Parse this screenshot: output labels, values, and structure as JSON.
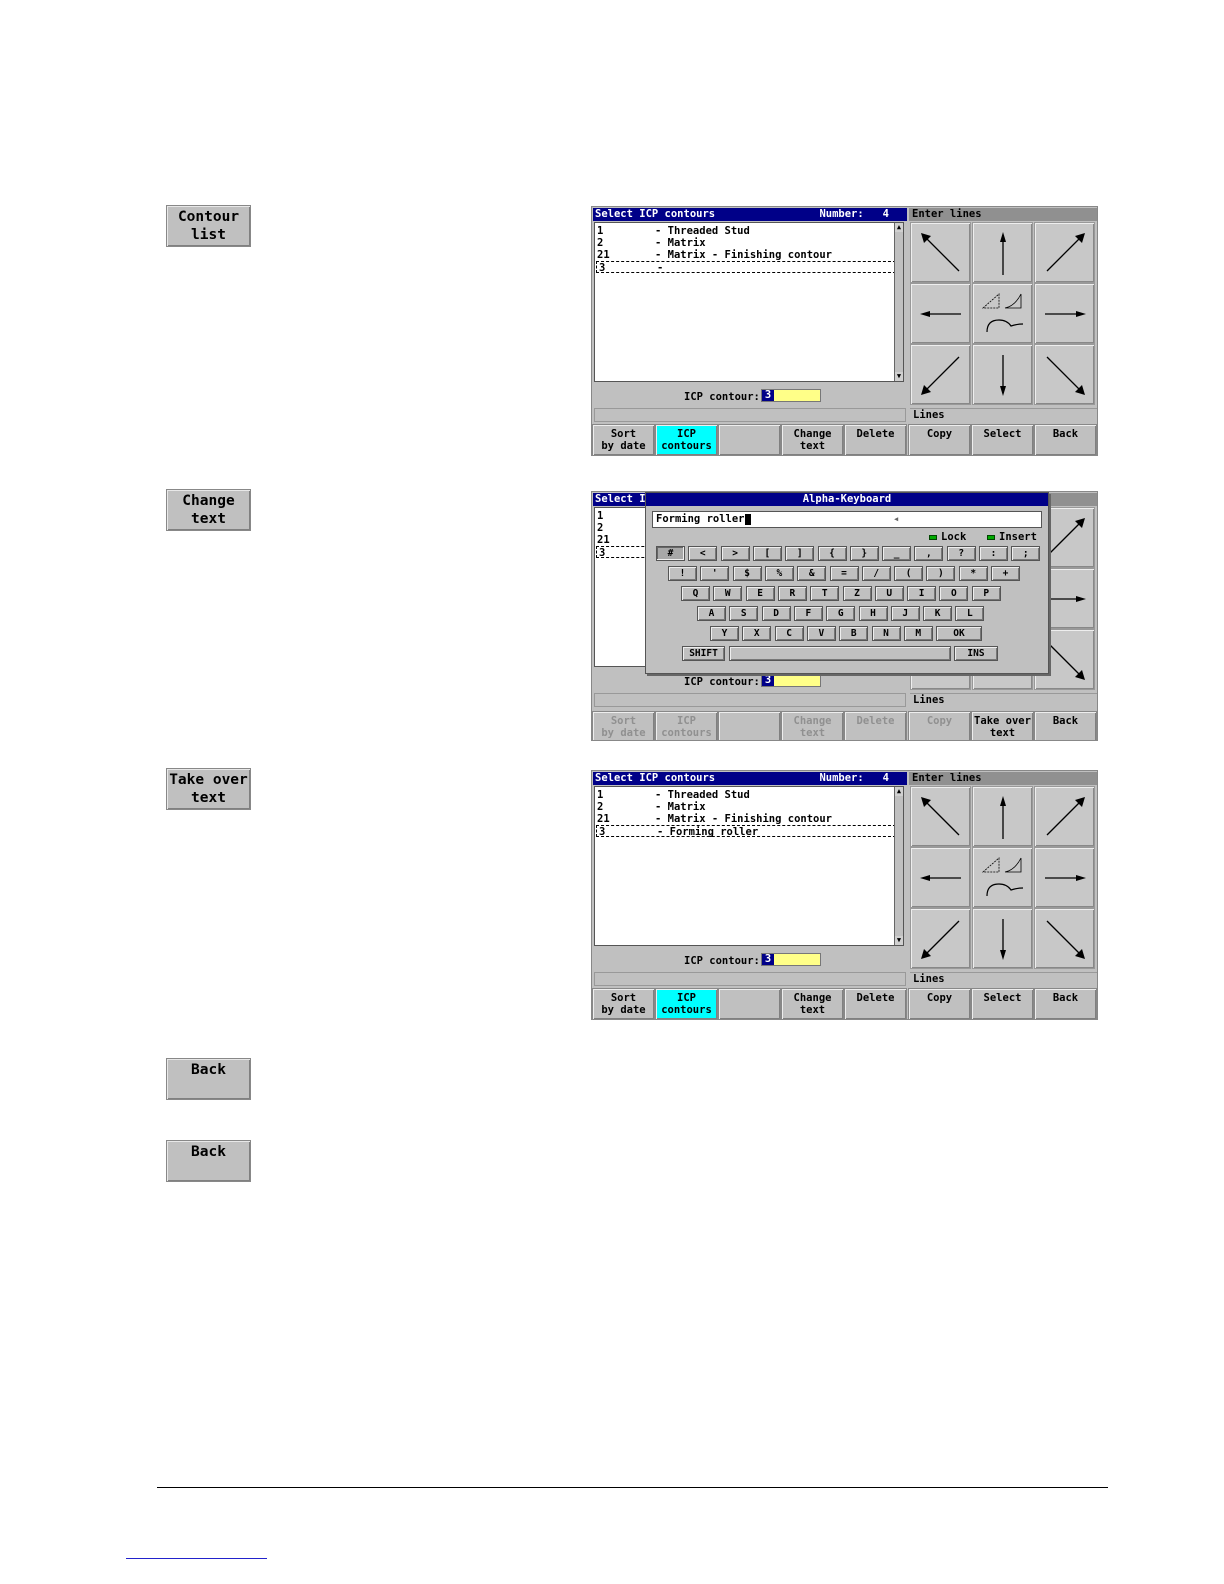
{
  "side_buttons": {
    "contour_list": "Contour\nlist",
    "change_text": "Change\ntext",
    "take_over_text": "Take over\ntext",
    "back_1": "Back",
    "back_2": "Back"
  },
  "screen1": {
    "title": "Select ICP contours",
    "number_label": "Number:   4",
    "right_title": "Enter lines",
    "rows": [
      {
        "nr": "1",
        "text": "- Threaded Stud"
      },
      {
        "nr": "2",
        "text": "- Matrix"
      },
      {
        "nr": "21",
        "text": "- Matrix - Finishing contour"
      },
      {
        "nr": "3",
        "text": "-"
      }
    ],
    "icp_label": "ICP contour:",
    "icp_value": "3",
    "lines_label": "Lines",
    "softkeys": [
      "Sort\nby date",
      "ICP\ncontours",
      "",
      "Change\ntext",
      "Delete",
      "Copy",
      "Select",
      "Back"
    ]
  },
  "screen2": {
    "title_partial": "Select I",
    "rows": [
      "1",
      "2",
      "21",
      "3"
    ],
    "icp_label": "ICP contour:",
    "icp_value": "3",
    "lines_label": "Lines",
    "keyboard": {
      "title": "Alpha-Keyboard",
      "input": "Forming roller",
      "input_arrow": "◂",
      "lock": "Lock",
      "insert": "Insert",
      "row1": [
        "#",
        "<",
        ">",
        "[",
        "]",
        "{",
        "}",
        "_",
        ",",
        "?",
        ":",
        ";"
      ],
      "row2": [
        "!",
        "'",
        "$",
        "%",
        "&",
        "=",
        "/",
        "(",
        ")",
        "*",
        "+"
      ],
      "row3": [
        "Q",
        "W",
        "E",
        "R",
        "T",
        "Z",
        "U",
        "I",
        "O",
        "P"
      ],
      "row4": [
        "A",
        "S",
        "D",
        "F",
        "G",
        "H",
        "J",
        "K",
        "L"
      ],
      "row5": [
        "Y",
        "X",
        "C",
        "V",
        "B",
        "N",
        "M"
      ],
      "ok": "OK",
      "shift": "SHIFT",
      "ins": "INS"
    },
    "softkeys": [
      "Sort\nby date",
      "ICP\ncontours",
      "",
      "Change\ntext",
      "Delete",
      "Copy",
      "Take over\ntext",
      "Back"
    ]
  },
  "screen3": {
    "title": "Select ICP contours",
    "number_label": "Number:   4",
    "right_title": "Enter lines",
    "rows": [
      {
        "nr": "1",
        "text": "- Threaded Stud"
      },
      {
        "nr": "2",
        "text": "- Matrix"
      },
      {
        "nr": "21",
        "text": "- Matrix - Finishing contour"
      },
      {
        "nr": "3",
        "text": "- Forming roller"
      }
    ],
    "icp_label": "ICP contour:",
    "icp_value": "3",
    "lines_label": "Lines",
    "softkeys": [
      "Sort\nby date",
      "ICP\ncontours",
      "",
      "Change\ntext",
      "Delete",
      "Copy",
      "Select",
      "Back"
    ]
  },
  "icons": {
    "grid": [
      "arrow-up-left-icon",
      "arrow-up-icon",
      "arrow-up-right-icon",
      "arrow-left-icon",
      "contour-shapes-icon",
      "arrow-right-icon",
      "arrow-down-left-icon",
      "arrow-down-icon",
      "arrow-down-right-icon"
    ]
  }
}
